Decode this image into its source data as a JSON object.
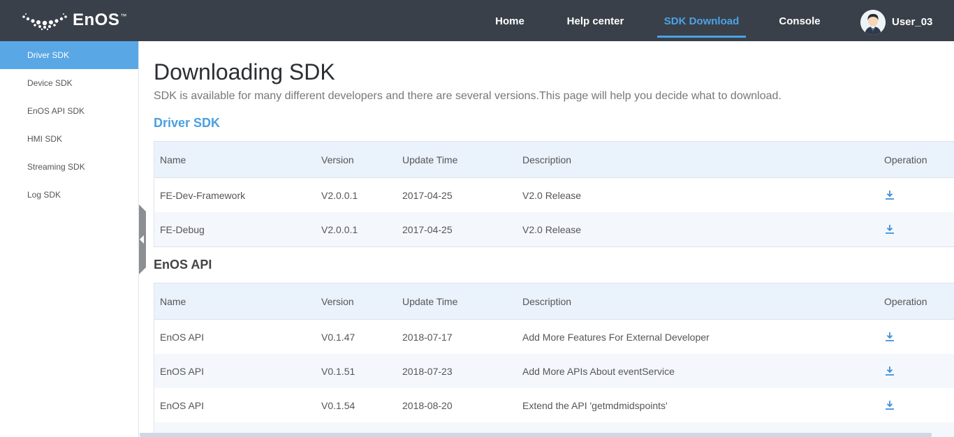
{
  "header": {
    "logo_text": "EnOS",
    "logo_tm": "™",
    "nav": [
      {
        "label": "Home"
      },
      {
        "label": "Help center"
      },
      {
        "label": "SDK Download"
      },
      {
        "label": "Console"
      }
    ],
    "active_nav": "SDK Download",
    "user_name": "User_03"
  },
  "sidebar": {
    "items": [
      {
        "label": "Driver SDK"
      },
      {
        "label": "Device SDK"
      },
      {
        "label": "EnOS API SDK"
      },
      {
        "label": "HMI SDK"
      },
      {
        "label": "Streaming SDK"
      },
      {
        "label": "Log SDK"
      }
    ],
    "active_item": "Driver SDK"
  },
  "main": {
    "title": "Downloading SDK",
    "description": "SDK is available for many different developers and there are several versions.This page will help you decide what to download.",
    "columns": [
      "Name",
      "Version",
      "Update Time",
      "Description",
      "Operation"
    ],
    "sections": [
      {
        "title": "Driver SDK",
        "rows": [
          {
            "name": "FE-Dev-Framework",
            "version": "V2.0.0.1",
            "update_time": "2017-04-25",
            "description": "V2.0 Release"
          },
          {
            "name": "FE-Debug",
            "version": "V2.0.0.1",
            "update_time": "2017-04-25",
            "description": "V2.0 Release"
          }
        ]
      },
      {
        "title": "EnOS API",
        "rows": [
          {
            "name": "EnOS API",
            "version": "V0.1.47",
            "update_time": "2018-07-17",
            "description": "Add More Features For External Developer"
          },
          {
            "name": "EnOS API",
            "version": "V0.1.51",
            "update_time": "2018-07-23",
            "description": "Add More APIs About eventService"
          },
          {
            "name": "EnOS API",
            "version": "V0.1.54",
            "update_time": "2018-08-20",
            "description": "Extend the API 'getmdmidspoints'"
          }
        ]
      }
    ]
  },
  "icons": {
    "download": "download-icon",
    "collapse": "chevron-left-icon",
    "avatar": "user-avatar"
  },
  "colors": {
    "topbar": "#3a4049",
    "accent": "#4aa3e8",
    "sidebar_active": "#5aa7e6",
    "table_header": "#eaf2fb",
    "table_alt_row": "#f4f8fd"
  }
}
